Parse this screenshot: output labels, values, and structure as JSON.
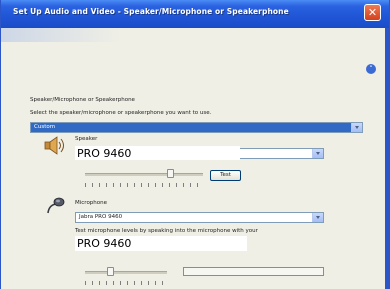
{
  "window": {
    "title": "Set Up Audio and Video - Speaker/Microphone or Speakerphone",
    "close_glyph": "✕"
  },
  "device_section": {
    "heading": "Speaker/Microphone or Speakerphone",
    "instruction": "Select the speaker/microphone or speakerphone you want to use.",
    "selected_value": "Custom"
  },
  "speaker": {
    "label": "Speaker",
    "overlay_text": "PRO 9460",
    "test_button": "Test",
    "volume_level": 0.72
  },
  "microphone": {
    "label": "Microphone",
    "selected_value": "Jabra PRO 9460",
    "instruction": "Test microphone levels by speaking into the microphone with your",
    "overlay_text": "PRO 9460",
    "volume_level": 0.3,
    "meter_level": 0.0
  },
  "icons": {
    "expand": "collapse-chevron-icon",
    "speaker": "speaker-icon",
    "microphone": "microphone-icon"
  },
  "colors": {
    "titlebar": "#1f55d6",
    "selected_highlight": "#316ac5",
    "window_face": "#f0efe6"
  }
}
